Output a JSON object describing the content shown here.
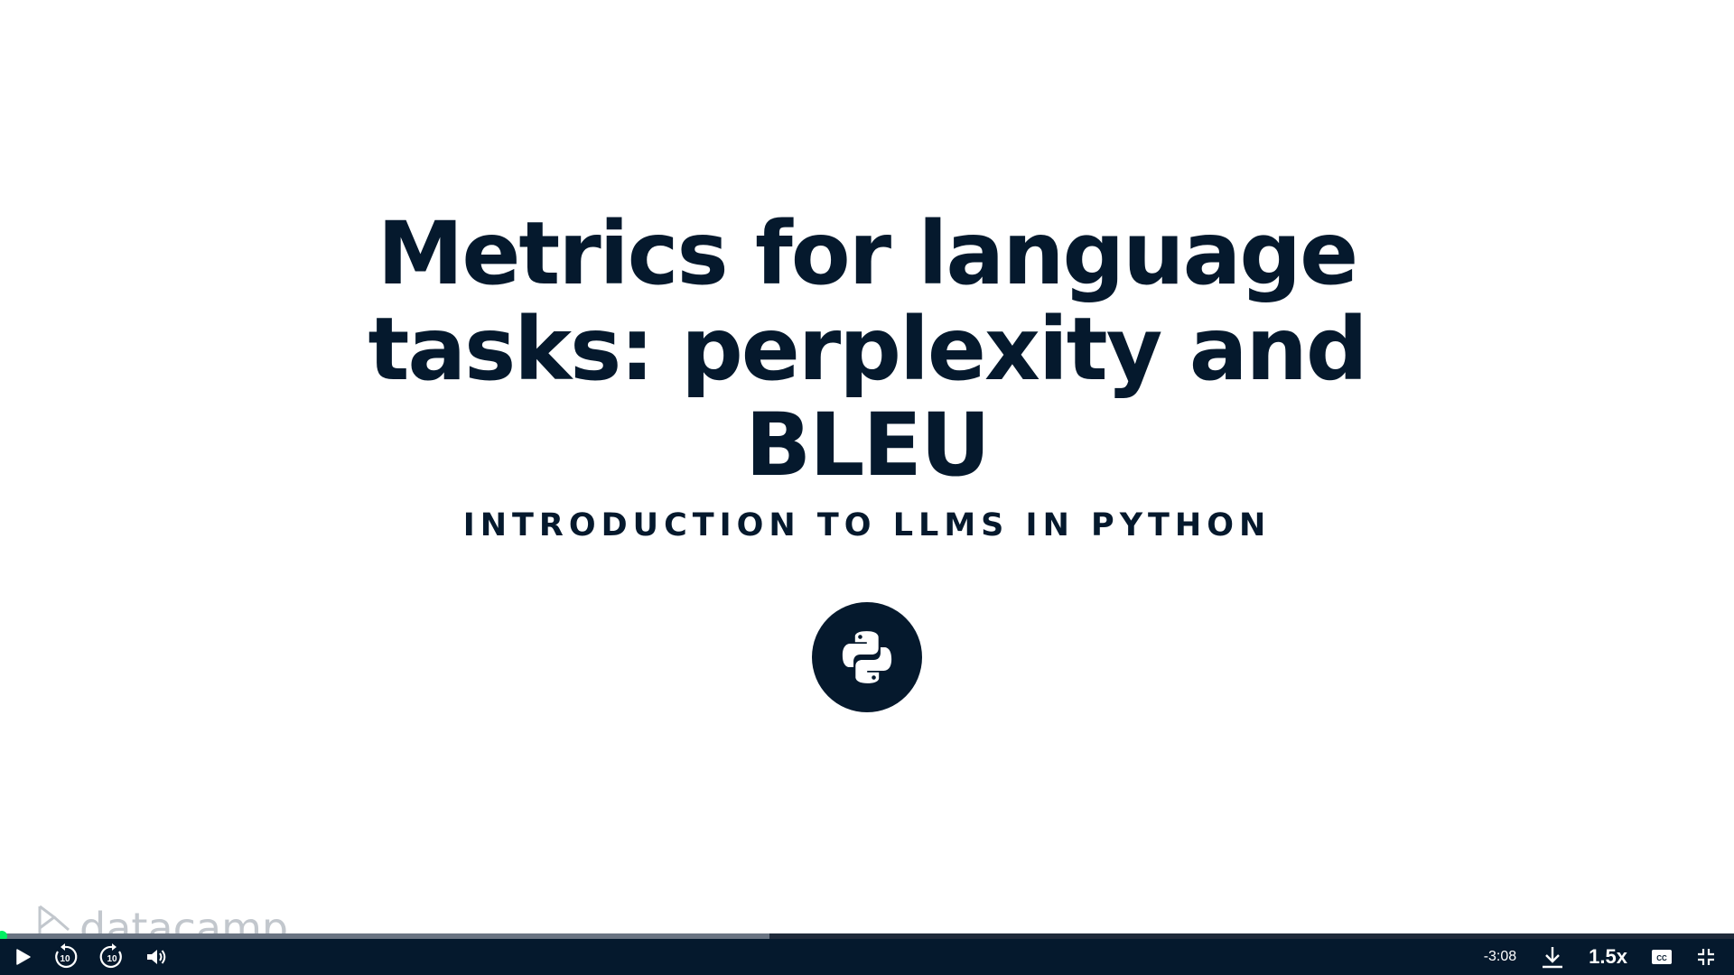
{
  "slide": {
    "title_lines": [
      "Metrics for language",
      "tasks: perplexity and",
      "BLEU"
    ],
    "subtitle": "INTRODUCTION TO LLMS IN PYTHON",
    "badge_icon": "python-logo-icon",
    "watermark": "datacamp"
  },
  "player": {
    "progress": 0.444,
    "remaining_time": "-3:08",
    "speed": "1.5x",
    "icons": {
      "play": "play-icon",
      "rewind": "rewind-10-icon",
      "forward": "forward-10-icon",
      "volume": "volume-icon",
      "download": "download-icon",
      "captions": "captions-icon",
      "fullscreen": "exit-fullscreen-icon"
    },
    "skip_seconds": "10"
  },
  "colors": {
    "navy": "#05192d",
    "accent_green": "#03ef62",
    "progress_fill": "#6a7482"
  }
}
